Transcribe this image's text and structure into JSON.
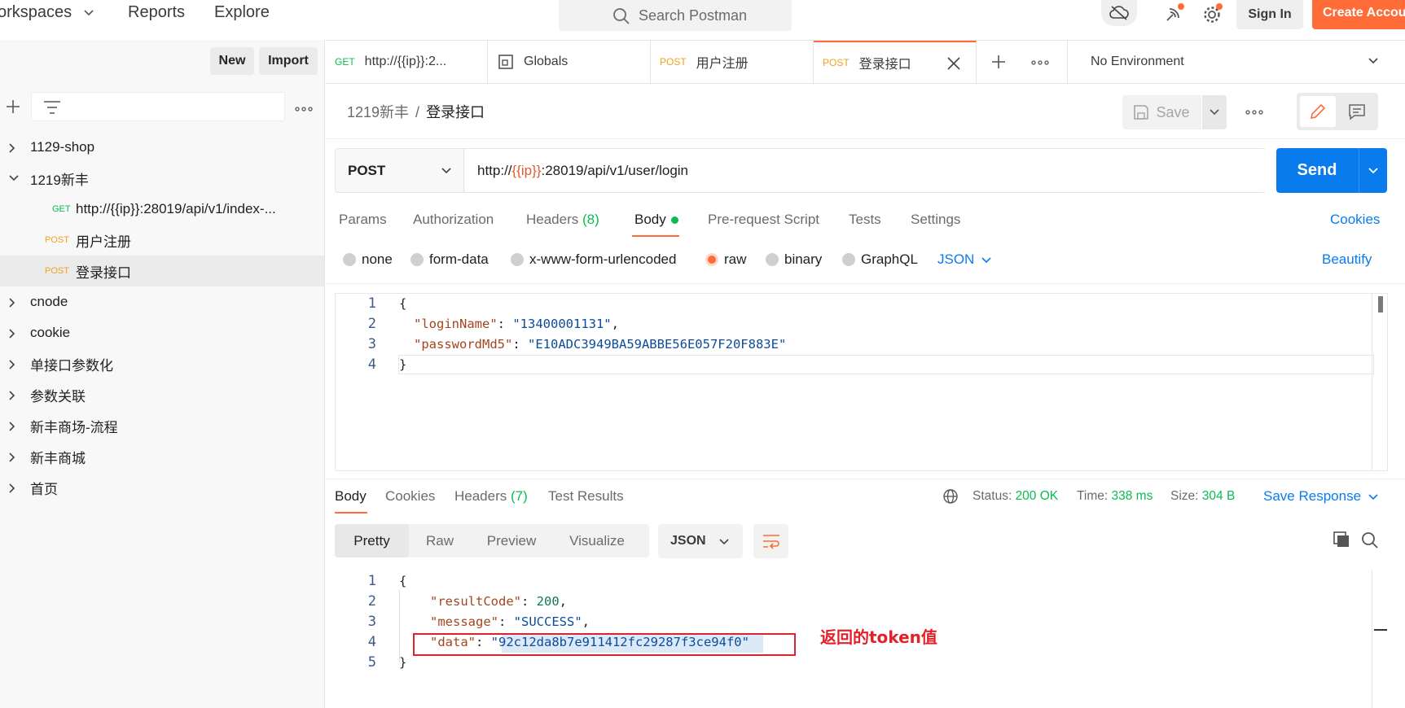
{
  "header": {
    "workspaces": "orkspaces",
    "reports": "Reports",
    "explore": "Explore",
    "search_placeholder": "Search Postman",
    "sign_in": "Sign In",
    "create_account": "Create Account"
  },
  "sidebar": {
    "new_label": "New",
    "import_label": "Import",
    "tree": [
      {
        "label": "1129-shop",
        "expanded": false
      },
      {
        "label": "1219新丰",
        "expanded": true
      },
      {
        "method": "GET",
        "label": "http://{{ip}}:28019/api/v1/index-..."
      },
      {
        "method": "POST",
        "label": "用户注册"
      },
      {
        "method": "POST",
        "label": "登录接口",
        "selected": true
      },
      {
        "label": "cnode",
        "expanded": false
      },
      {
        "label": "cookie",
        "expanded": false
      },
      {
        "label": "单接口参数化",
        "expanded": false
      },
      {
        "label": "参数关联",
        "expanded": false
      },
      {
        "label": "新丰商场-流程",
        "expanded": false
      },
      {
        "label": "新丰商城",
        "expanded": false
      },
      {
        "label": "首页",
        "expanded": false
      }
    ]
  },
  "tabs": [
    {
      "method": "GET",
      "label": "http://{{ip}}:2..."
    },
    {
      "method": "",
      "label": "Globals"
    },
    {
      "method": "POST",
      "label": "用户注册"
    },
    {
      "method": "POST",
      "label": "登录接口",
      "active": true
    }
  ],
  "environment": "No Environment",
  "breadcrumb": {
    "parent": "1219新丰",
    "separator": "/",
    "current": "登录接口"
  },
  "save_label": "Save",
  "request": {
    "method": "POST",
    "url_prefix": "http://",
    "url_var": "{{ip}}",
    "url_suffix": ":28019/api/v1/user/login",
    "send_label": "Send"
  },
  "request_tabs": {
    "params": "Params",
    "authorization": "Authorization",
    "headers": "Headers",
    "headers_count": "(8)",
    "body": "Body",
    "pre_request": "Pre-request Script",
    "tests": "Tests",
    "settings": "Settings",
    "cookies": "Cookies"
  },
  "body_types": {
    "none": "none",
    "form_data": "form-data",
    "urlencoded": "x-www-form-urlencoded",
    "raw": "raw",
    "binary": "binary",
    "graphql": "GraphQL",
    "format": "JSON",
    "beautify": "Beautify",
    "selected": "raw"
  },
  "request_body": {
    "line_numbers": [
      "1",
      "2",
      "3",
      "4"
    ],
    "open": "{",
    "key1": "\"loginName\"",
    "val1": "\"13400001131\"",
    "key2": "\"passwordMd5\"",
    "val2": "\"E10ADC3949BA59ABBE56E057F20F883E\"",
    "close": "}"
  },
  "response_tabs": {
    "body": "Body",
    "cookies": "Cookies",
    "headers": "Headers",
    "headers_count": "(7)",
    "test_results": "Test Results"
  },
  "response_meta": {
    "status_label": "Status:",
    "status_value": "200 OK",
    "time_label": "Time:",
    "time_value": "338 ms",
    "size_label": "Size:",
    "size_value": "304 B",
    "save_response": "Save Response"
  },
  "response_view": {
    "pretty": "Pretty",
    "raw": "Raw",
    "preview": "Preview",
    "visualize": "Visualize",
    "format": "JSON"
  },
  "response_body": {
    "line_numbers": [
      "1",
      "2",
      "3",
      "4",
      "5"
    ],
    "open": "{",
    "key1": "\"resultCode\"",
    "val1": "200",
    "key2": "\"message\"",
    "val2": "\"SUCCESS\"",
    "key3": "\"data\"",
    "val3": "\"92c12da8b7e911412fc29287f3ce94f0\"",
    "close": "}"
  },
  "annotation": "返回的token值",
  "colors": {
    "accent": "#ff6c37",
    "primary_blue": "#097bed",
    "success_green": "#0cbb52",
    "annotation_red": "#e0232a"
  }
}
